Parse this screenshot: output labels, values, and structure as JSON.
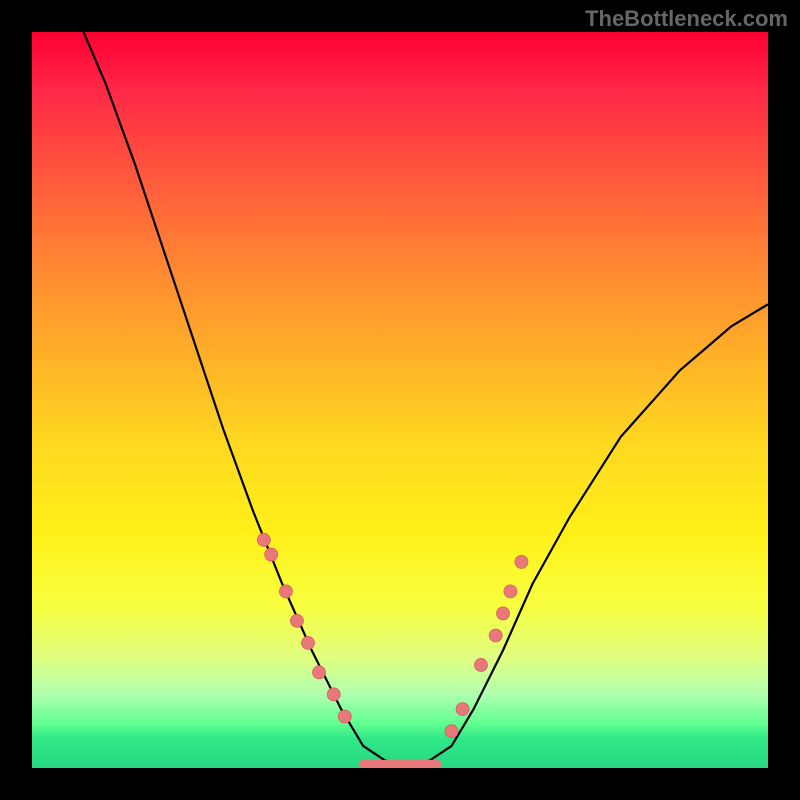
{
  "watermark": "TheBottleneck.com",
  "chart_data": {
    "type": "line",
    "title": "",
    "xlabel": "",
    "ylabel": "",
    "xlim": [
      0,
      100
    ],
    "ylim": [
      0,
      100
    ],
    "curve_points": [
      {
        "x": 7,
        "y": 100
      },
      {
        "x": 10,
        "y": 93
      },
      {
        "x": 14,
        "y": 82
      },
      {
        "x": 18,
        "y": 70
      },
      {
        "x": 22,
        "y": 58
      },
      {
        "x": 26,
        "y": 46
      },
      {
        "x": 30,
        "y": 35
      },
      {
        "x": 34,
        "y": 25
      },
      {
        "x": 38,
        "y": 16
      },
      {
        "x": 42,
        "y": 8
      },
      {
        "x": 45,
        "y": 3
      },
      {
        "x": 48,
        "y": 1
      },
      {
        "x": 51,
        "y": 0.5
      },
      {
        "x": 54,
        "y": 1
      },
      {
        "x": 57,
        "y": 3
      },
      {
        "x": 60,
        "y": 8
      },
      {
        "x": 64,
        "y": 16
      },
      {
        "x": 68,
        "y": 25
      },
      {
        "x": 73,
        "y": 34
      },
      {
        "x": 80,
        "y": 45
      },
      {
        "x": 88,
        "y": 54
      },
      {
        "x": 95,
        "y": 60
      },
      {
        "x": 100,
        "y": 63
      }
    ],
    "markers_left": [
      {
        "x": 31.5,
        "y": 31
      },
      {
        "x": 32.5,
        "y": 29
      },
      {
        "x": 34.5,
        "y": 24
      },
      {
        "x": 36,
        "y": 20
      },
      {
        "x": 37.5,
        "y": 17
      },
      {
        "x": 39,
        "y": 13
      },
      {
        "x": 41,
        "y": 10
      },
      {
        "x": 42.5,
        "y": 7
      }
    ],
    "markers_right": [
      {
        "x": 57,
        "y": 5
      },
      {
        "x": 58.5,
        "y": 8
      },
      {
        "x": 61,
        "y": 14
      },
      {
        "x": 63,
        "y": 18
      },
      {
        "x": 64,
        "y": 21
      },
      {
        "x": 65,
        "y": 24
      },
      {
        "x": 66.5,
        "y": 28
      }
    ],
    "flat_segment": {
      "x_start": 45,
      "x_end": 55,
      "y": 0.5
    },
    "colors": {
      "curve": "#000000",
      "markers": "#e8787a",
      "marker_stroke": "#d86060",
      "flat_line": "#e8787a",
      "gradient_top": "#ff0033",
      "gradient_bottom": "#28d880"
    }
  }
}
